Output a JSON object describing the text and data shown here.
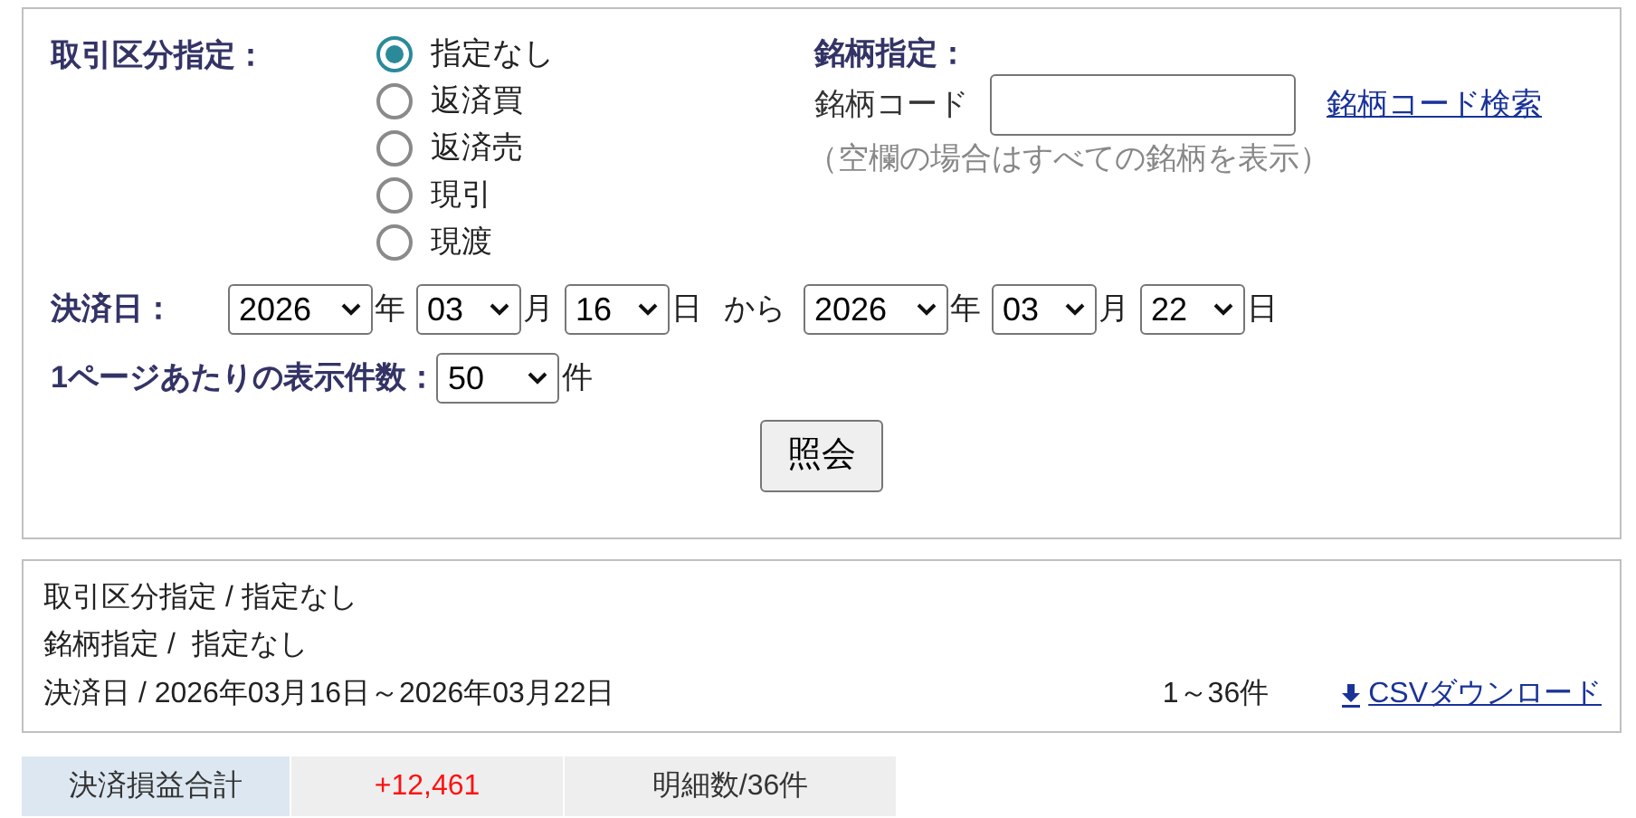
{
  "search_form": {
    "trade_type": {
      "label": "取引区分指定：",
      "options": [
        {
          "label": "指定なし",
          "selected": true
        },
        {
          "label": "返済買",
          "selected": false
        },
        {
          "label": "返済売",
          "selected": false
        },
        {
          "label": "現引",
          "selected": false
        },
        {
          "label": "現渡",
          "selected": false
        }
      ]
    },
    "stock": {
      "label": "銘柄指定：",
      "code_label": "銘柄コード",
      "search_link": "銘柄コード検索",
      "note": "（空欄の場合はすべての銘柄を表示）"
    },
    "settlement_date": {
      "label": "決済日：",
      "from": [
        {
          "value": "2026",
          "unit": "年"
        },
        {
          "value": "03",
          "unit": "月"
        },
        {
          "value": "16",
          "unit": "日"
        }
      ],
      "separator": "から",
      "to": [
        {
          "value": "2026",
          "unit": "年"
        },
        {
          "value": "03",
          "unit": "月"
        },
        {
          "value": "22",
          "unit": "日"
        }
      ]
    },
    "per_page": {
      "label": "1ページあたりの表示件数：",
      "value": "50",
      "unit": "件"
    },
    "submit_button": "照会"
  },
  "summary": {
    "lines": [
      "取引区分指定 / 指定なし",
      "銘柄指定 /  指定なし",
      "決済日 / 2026年03月16日～2026年03月22日"
    ],
    "count": "1～36件",
    "csv_link": "CSVダウンロード"
  },
  "totals": {
    "label": "決済損益合計",
    "value": "+12,461",
    "detail": "明細数/36件"
  }
}
